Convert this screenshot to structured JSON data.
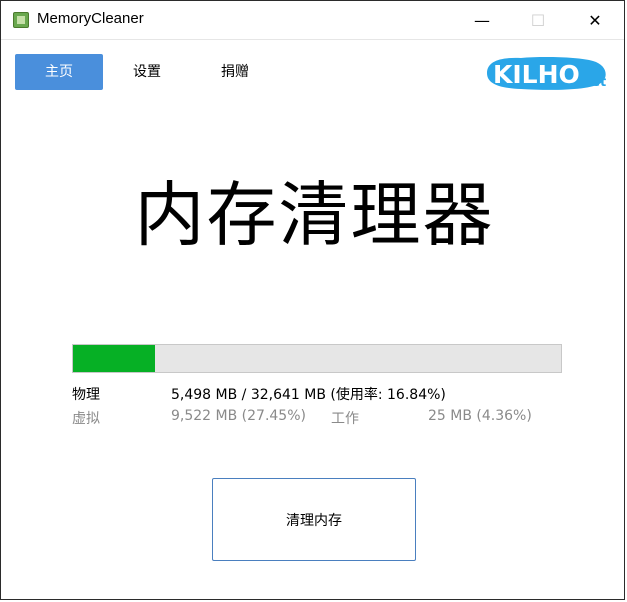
{
  "window": {
    "title": "MemoryCleaner",
    "controls": {
      "minimize": "—",
      "maximize": "☐",
      "close": "✕"
    }
  },
  "nav": {
    "tabs": [
      {
        "label": "主页",
        "active": true
      },
      {
        "label": "设置",
        "active": false
      },
      {
        "label": "捐赠",
        "active": false
      }
    ]
  },
  "logo": {
    "text_main": "KILHO",
    "text_suffix": ".net",
    "color": "#2aa6e8"
  },
  "headline": "内存清理器",
  "memory": {
    "usage_fraction": 0.1684,
    "fill_color": "#06b025",
    "physical": {
      "label": "物理",
      "value": "5,498 MB / 32,641 MB (使用率: 16.84%)"
    },
    "virtual": {
      "label": "虚拟",
      "value": "9,522 MB (27.45%)"
    },
    "working": {
      "label": "工作",
      "value": "25 MB (4.36%)"
    }
  },
  "actions": {
    "clean_label": "清理内存"
  },
  "colors": {
    "accent": "#4a8fdc",
    "button_border": "#4a7fbf"
  }
}
